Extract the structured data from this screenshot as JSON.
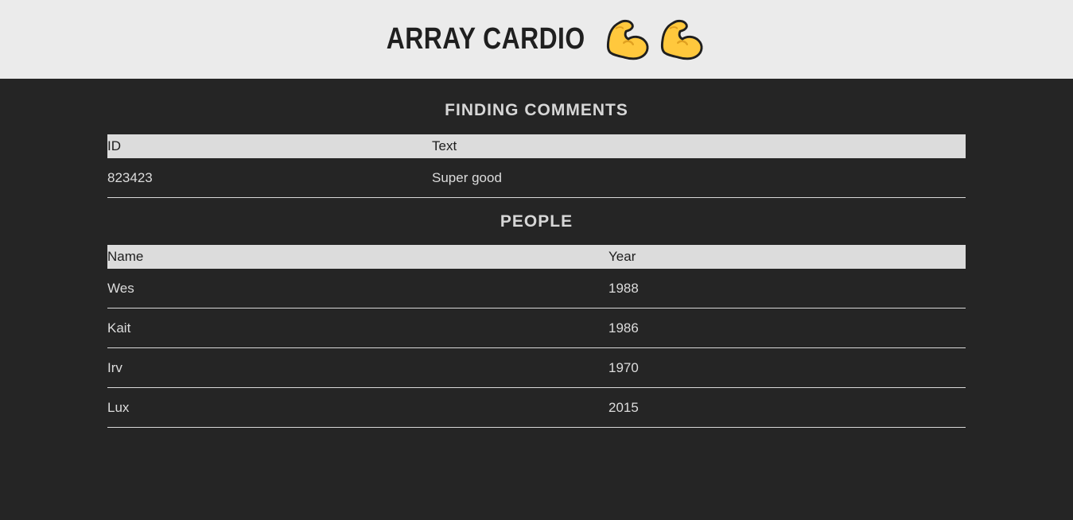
{
  "header": {
    "title": "ARRAY CARDIO"
  },
  "comments_section": {
    "heading": "FINDING COMMENTS",
    "columns": [
      "ID",
      "Text"
    ],
    "rows": [
      [
        "823423",
        "Super good"
      ]
    ]
  },
  "people_section": {
    "heading": "PEOPLE",
    "columns": [
      "Name",
      "Year"
    ],
    "rows": [
      [
        "Wes",
        "1988"
      ],
      [
        "Kait",
        "1986"
      ],
      [
        "Irv",
        "1970"
      ],
      [
        "Lux",
        "2015"
      ]
    ]
  },
  "colors": {
    "header_bg": "#ebebeb",
    "page_bg": "#252525",
    "table_header_bg": "#dcdcdc",
    "text_light": "#dcdcdc",
    "emoji_yellow": "#ffc83d"
  }
}
